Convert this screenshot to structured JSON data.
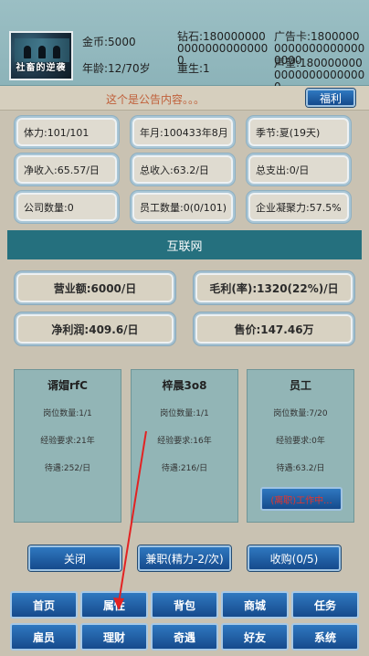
{
  "player": {
    "avatar_caption": "社畜的逆袭",
    "gold": "金币:5000",
    "age": "年龄:12/70岁",
    "diamond": "钻石:18000000000000000000000",
    "rebirth": "重生:1",
    "ad_card": "广告卡:180000000000000000000000",
    "reputation": "声望:18000000000000000000000"
  },
  "notice": {
    "text": "这个是公告内容。。。",
    "welfare_button": "福利"
  },
  "stats": [
    "体力:101/101",
    "年月:100433年8月",
    "季节:夏(19天)",
    "净收入:65.57/日",
    "总收入:63.2/日",
    "总支出:0/日",
    "公司数量:0",
    "员工数量:0(0/101)",
    "企业凝聚力:57.5%"
  ],
  "panel": {
    "title": "互联网",
    "revenue": "营业额:6000/日",
    "gross_margin": "毛利(率):1320(22%)/日",
    "net_profit": "净利润:409.6/日",
    "price": "售价:147.46万"
  },
  "jobs": [
    {
      "title": "谞媢rfC",
      "positions": "岗位数量:1/1",
      "experience": "经验要求:21年",
      "salary": "待遇:252/日"
    },
    {
      "title": "梓晨3o8",
      "positions": "岗位数量:1/1",
      "experience": "经验要求:16年",
      "salary": "待遇:216/日"
    },
    {
      "title": "员工",
      "positions": "岗位数量:7/20",
      "experience": "经验要求:0年",
      "salary": "待遇:63.2/日",
      "working_label": "(离职)工作中..."
    }
  ],
  "actions": {
    "close": "关闭",
    "part_time": "兼职(精力-2/次)",
    "acquire": "收购(0/5)"
  },
  "nav": {
    "row1": [
      "首页",
      "属性",
      "背包",
      "商城",
      "任务"
    ],
    "row2": [
      "雇员",
      "理财",
      "奇遇",
      "好友",
      "系统"
    ]
  },
  "colors": {
    "accent_blue": "#1f5fa6",
    "panel_teal": "#25707e",
    "notice_text": "#c0603a",
    "working_red": "#e8332a"
  }
}
